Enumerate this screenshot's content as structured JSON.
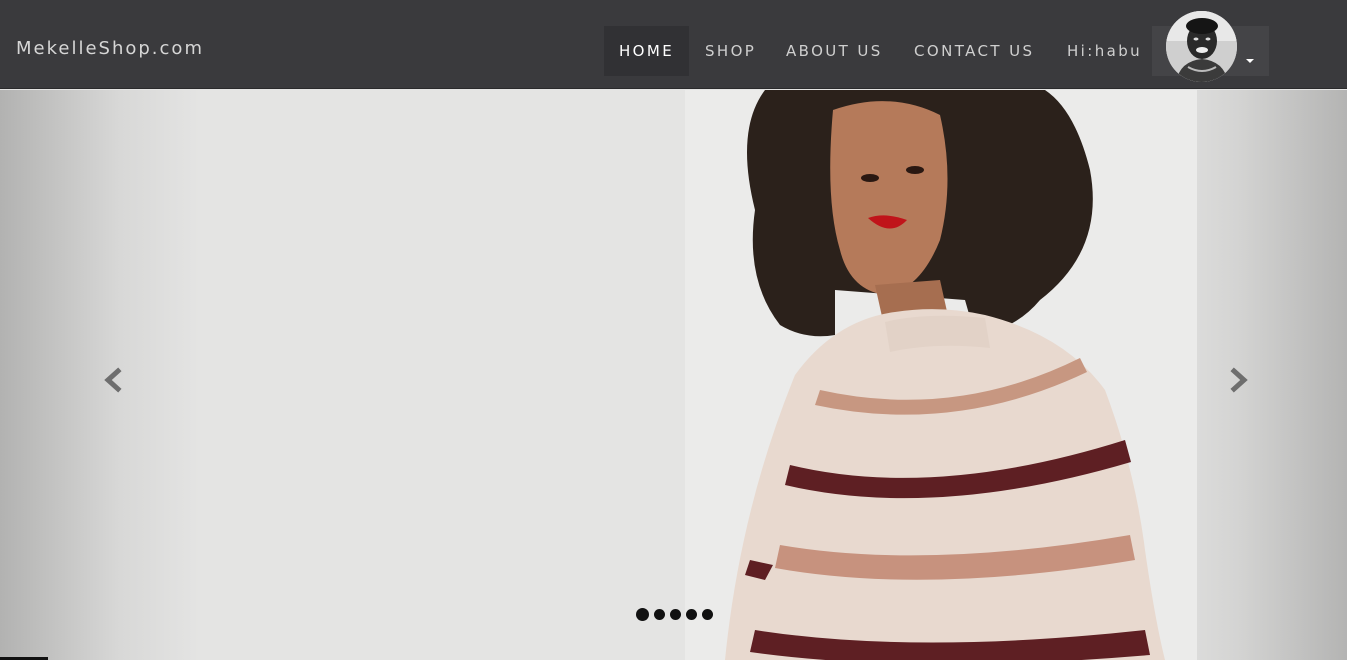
{
  "navbar": {
    "brand": "MekelleShop.com",
    "links": [
      {
        "label": "HOME",
        "active": true
      },
      {
        "label": "SHOP",
        "active": false
      },
      {
        "label": "ABOUT US",
        "active": false
      },
      {
        "label": "CONTACT US",
        "active": false
      }
    ],
    "greeting": "Hi:habu",
    "user_menu_icon": "caret-down-icon",
    "avatar_icon": "user-avatar"
  },
  "carousel": {
    "slide_count": 5,
    "active_index": 0,
    "prev_icon": "chevron-left-icon",
    "next_icon": "chevron-right-icon",
    "slide_image": "model-in-striped-sweater"
  },
  "colors": {
    "navbar_bg": "#3a3a3d",
    "nav_text": "#cfcfcf",
    "active_bg": "#313134",
    "slide_bg": "#e4e4e3"
  }
}
